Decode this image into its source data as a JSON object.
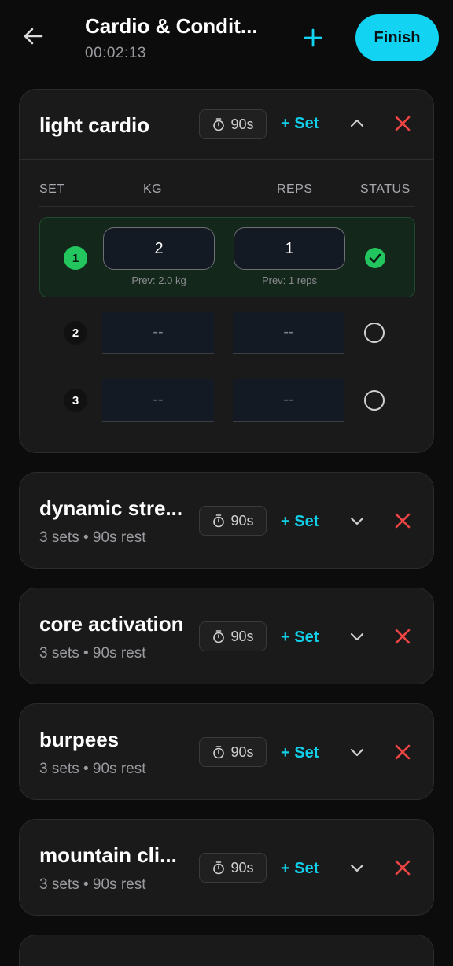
{
  "header": {
    "back_icon": "arrow-left-icon",
    "title": "Cardio & Condit...",
    "timer": "00:02:13",
    "add_icon": "plus-icon",
    "finish_label": "Finish"
  },
  "colors": {
    "accent": "#12d4f2",
    "danger": "#ef4444",
    "success": "#22c55e",
    "card_bg": "#1a1a1a"
  },
  "exercises": [
    {
      "name": "light cardio",
      "rest": "90s",
      "add_set": "+ Set",
      "expanded": true,
      "columns": {
        "set": "SET",
        "kg": "KG",
        "reps": "REPS",
        "status": "STATUS"
      },
      "sets": [
        {
          "num": "1",
          "kg": "2",
          "reps": "1",
          "prev_kg": "Prev: 2.0 kg",
          "prev_reps": "Prev: 1 reps",
          "done": true
        },
        {
          "num": "2",
          "kg": "--",
          "reps": "--",
          "done": false
        },
        {
          "num": "3",
          "kg": "--",
          "reps": "--",
          "done": false
        }
      ]
    },
    {
      "name": "dynamic stre...",
      "sub": "3 sets • 90s rest",
      "rest": "90s",
      "add_set": "+ Set",
      "expanded": false
    },
    {
      "name": "core activation",
      "sub": "3 sets • 90s rest",
      "rest": "90s",
      "add_set": "+ Set",
      "expanded": false
    },
    {
      "name": "burpees",
      "sub": "3 sets • 90s rest",
      "rest": "90s",
      "add_set": "+ Set",
      "expanded": false
    },
    {
      "name": "mountain cli...",
      "sub": "3 sets • 90s rest",
      "rest": "90s",
      "add_set": "+ Set",
      "expanded": false
    }
  ]
}
